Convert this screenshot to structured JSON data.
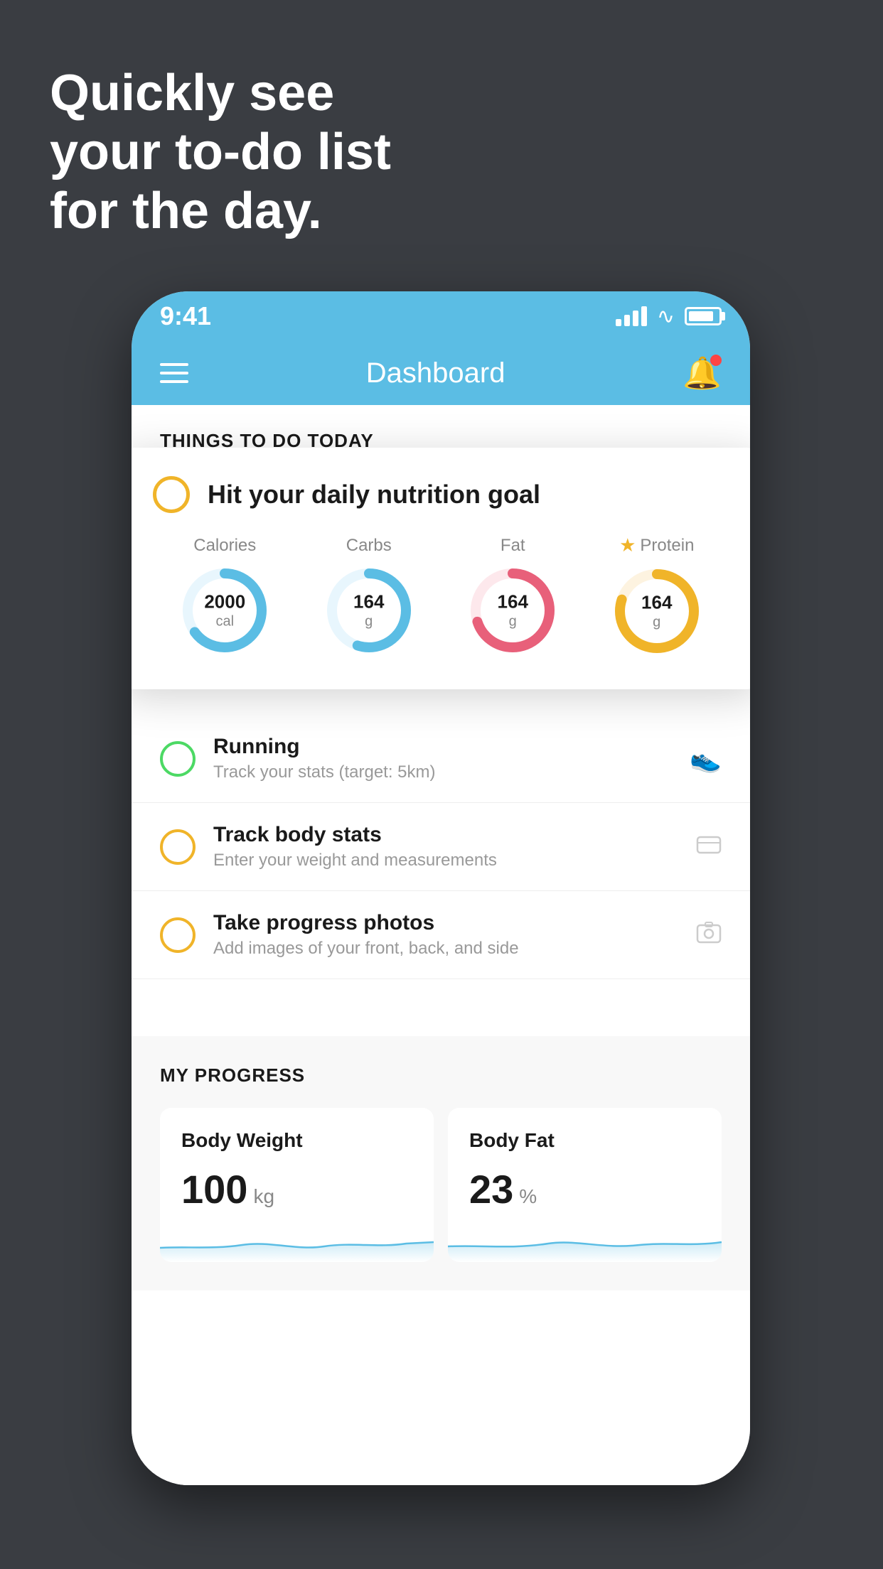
{
  "tagline": {
    "line1": "Quickly see",
    "line2": "your to-do list",
    "line3": "for the day."
  },
  "status_bar": {
    "time": "9:41"
  },
  "header": {
    "title": "Dashboard"
  },
  "section1_title": "THINGS TO DO TODAY",
  "nutrition_card": {
    "title": "Hit your daily nutrition goal",
    "items": [
      {
        "label": "Calories",
        "value": "2000",
        "unit": "cal",
        "color": "#5bbde4",
        "percent": 65,
        "star": false
      },
      {
        "label": "Carbs",
        "value": "164",
        "unit": "g",
        "color": "#5bbde4",
        "percent": 55,
        "star": false
      },
      {
        "label": "Fat",
        "value": "164",
        "unit": "g",
        "color": "#e8607a",
        "percent": 70,
        "star": false
      },
      {
        "label": "Protein",
        "value": "164",
        "unit": "g",
        "color": "#f0b429",
        "percent": 80,
        "star": true
      }
    ]
  },
  "todo_items": [
    {
      "title": "Running",
      "subtitle": "Track your stats (target: 5km)",
      "circle_color": "green",
      "icon": "👟"
    },
    {
      "title": "Track body stats",
      "subtitle": "Enter your weight and measurements",
      "circle_color": "yellow",
      "icon": "⚖️"
    },
    {
      "title": "Take progress photos",
      "subtitle": "Add images of your front, back, and side",
      "circle_color": "yellow",
      "icon": "🪪"
    }
  ],
  "progress": {
    "section_title": "MY PROGRESS",
    "cards": [
      {
        "title": "Body Weight",
        "value": "100",
        "unit": "kg"
      },
      {
        "title": "Body Fat",
        "value": "23",
        "unit": "%"
      }
    ]
  }
}
